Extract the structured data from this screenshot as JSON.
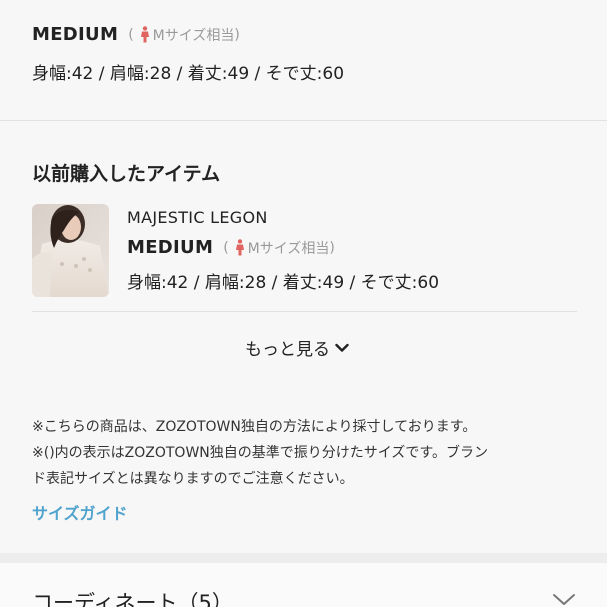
{
  "top_size": {
    "name": "MEDIUM",
    "paren_open": "(",
    "equiv_label": "Mサイズ相当",
    "paren_close": ")",
    "measurements": "身幅:42 / 肩幅:28 / 着丈:49 / そで丈:60"
  },
  "history": {
    "title": "以前購入したアイテム",
    "items": [
      {
        "brand": "MAJESTIC LEGON",
        "size_name": "MEDIUM",
        "paren_open": "(",
        "equiv_label": "Mサイズ相当",
        "paren_close": ")",
        "measurements": "身幅:42 / 肩幅:28 / 着丈:49 / そで丈:60"
      }
    ],
    "more_label": "もっと見る"
  },
  "notes": [
    "※こちらの商品は、ZOZOTOWN独自の方法により採寸しております。",
    "※()内の表示はZOZOTOWN独自の基準で振り分けたサイズです。ブラン",
    "ド表記サイズとは異なりますのでご注意ください。"
  ],
  "size_guide_label": "サイズガイド",
  "coordinate": {
    "label": "コーディネート（5）"
  },
  "colors": {
    "accent_link": "#4fa3cc",
    "person_icon": "#e0645f",
    "muted_text": "#9a9a9a"
  },
  "icons": [
    "person-icon",
    "chevron-down-icon"
  ]
}
